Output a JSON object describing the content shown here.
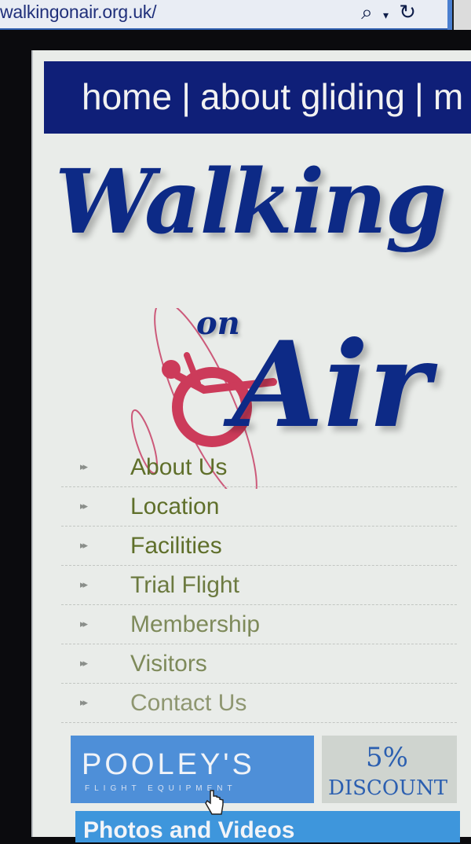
{
  "browser": {
    "url": "walkingonair.org.uk/",
    "search_icon": "search-icon",
    "dropdown_icon": "chevron-down-icon",
    "refresh_icon": "refresh-icon"
  },
  "topnav": {
    "items": [
      "home",
      "about gliding",
      "m"
    ],
    "separator": "|"
  },
  "logo": {
    "line1": "Walking",
    "line2": "on",
    "line3": "Air",
    "color": "#0d2a86",
    "symbol_color": "#cc3b5a"
  },
  "menu": {
    "bullet": "▸▸",
    "items": [
      "About Us",
      "Location",
      "Facilities",
      "Trial Flight",
      "Membership",
      "Visitors",
      "Contact Us"
    ]
  },
  "banner": {
    "brand": "POOLEY'S",
    "tagline": "FLIGHT EQUIPMENT",
    "discount_value": "5%",
    "discount_label": "DISCOUNT"
  },
  "photos": {
    "label": "Photos and Videos"
  },
  "colors": {
    "nav_bg": "#0f1f78",
    "menu_text": "#5f6f2a",
    "banner_blue": "#4e8fd8"
  }
}
